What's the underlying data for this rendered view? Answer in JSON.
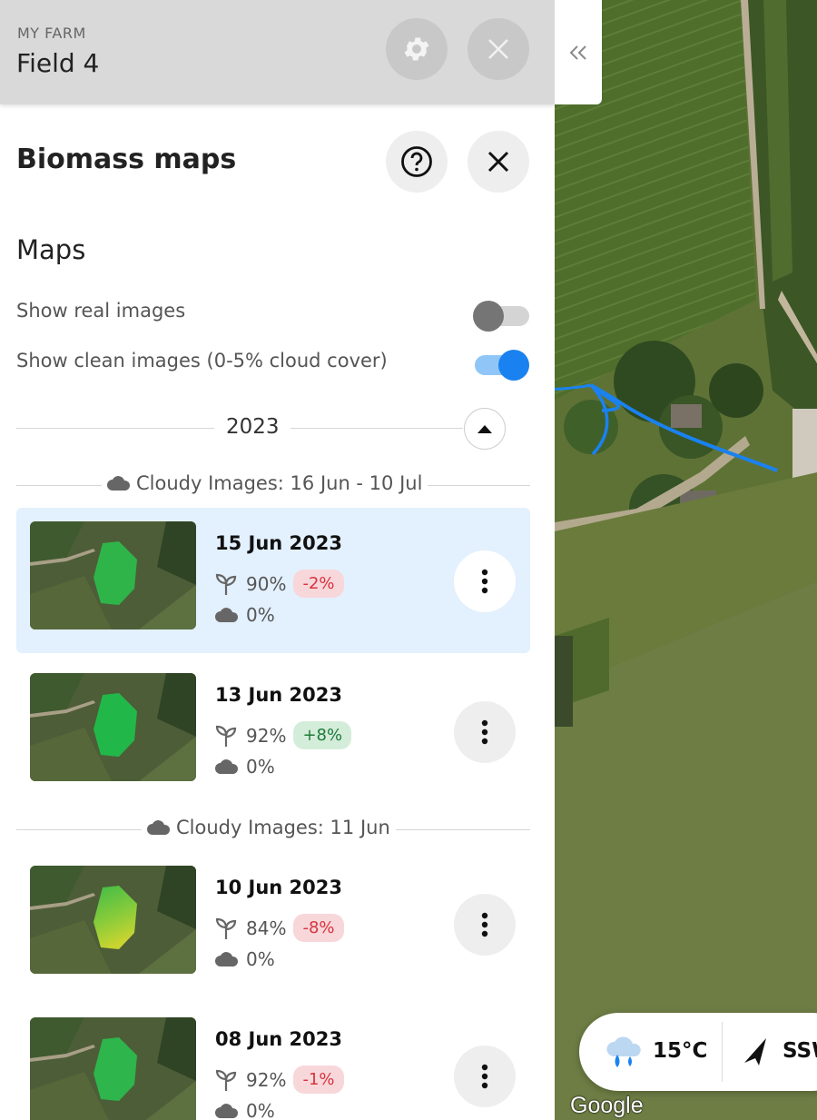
{
  "header": {
    "farm_label": "MY FARM",
    "field_title": "Field 4"
  },
  "panel": {
    "title": "Biomass maps",
    "section_title": "Maps",
    "toggles": [
      {
        "label": "Show real images",
        "on": false
      },
      {
        "label": "Show clean images (0-5% cloud cover)",
        "on": true
      }
    ],
    "year": "2023"
  },
  "groups": [
    {
      "header": "Cloudy Images: 16 Jun - 10 Jul"
    },
    {
      "header": "Cloudy Images: 11 Jun"
    }
  ],
  "images": [
    {
      "date": "15 Jun 2023",
      "biomass": "90%",
      "delta": "-2%",
      "trend": "negative",
      "cloud": "0%",
      "selected": true
    },
    {
      "date": "13 Jun 2023",
      "biomass": "92%",
      "delta": "+8%",
      "trend": "positive",
      "cloud": "0%",
      "selected": false
    },
    {
      "date": "10 Jun 2023",
      "biomass": "84%",
      "delta": "-8%",
      "trend": "negative",
      "cloud": "0%",
      "selected": false
    },
    {
      "date": "08 Jun 2023",
      "biomass": "92%",
      "delta": "-1%",
      "trend": "negative",
      "cloud": "0%",
      "selected": false
    }
  ],
  "weather": {
    "temperature": "15°C",
    "wind_direction": "SSW",
    "icon": "rain-cloud-icon"
  },
  "map": {
    "attribution": "Google"
  },
  "colors": {
    "accent": "#1a82f0",
    "selected_card": "#e3f0fd",
    "negative": "#d6333f",
    "positive": "#1e7a3a",
    "annotation_arrow": "#1a82f0"
  }
}
